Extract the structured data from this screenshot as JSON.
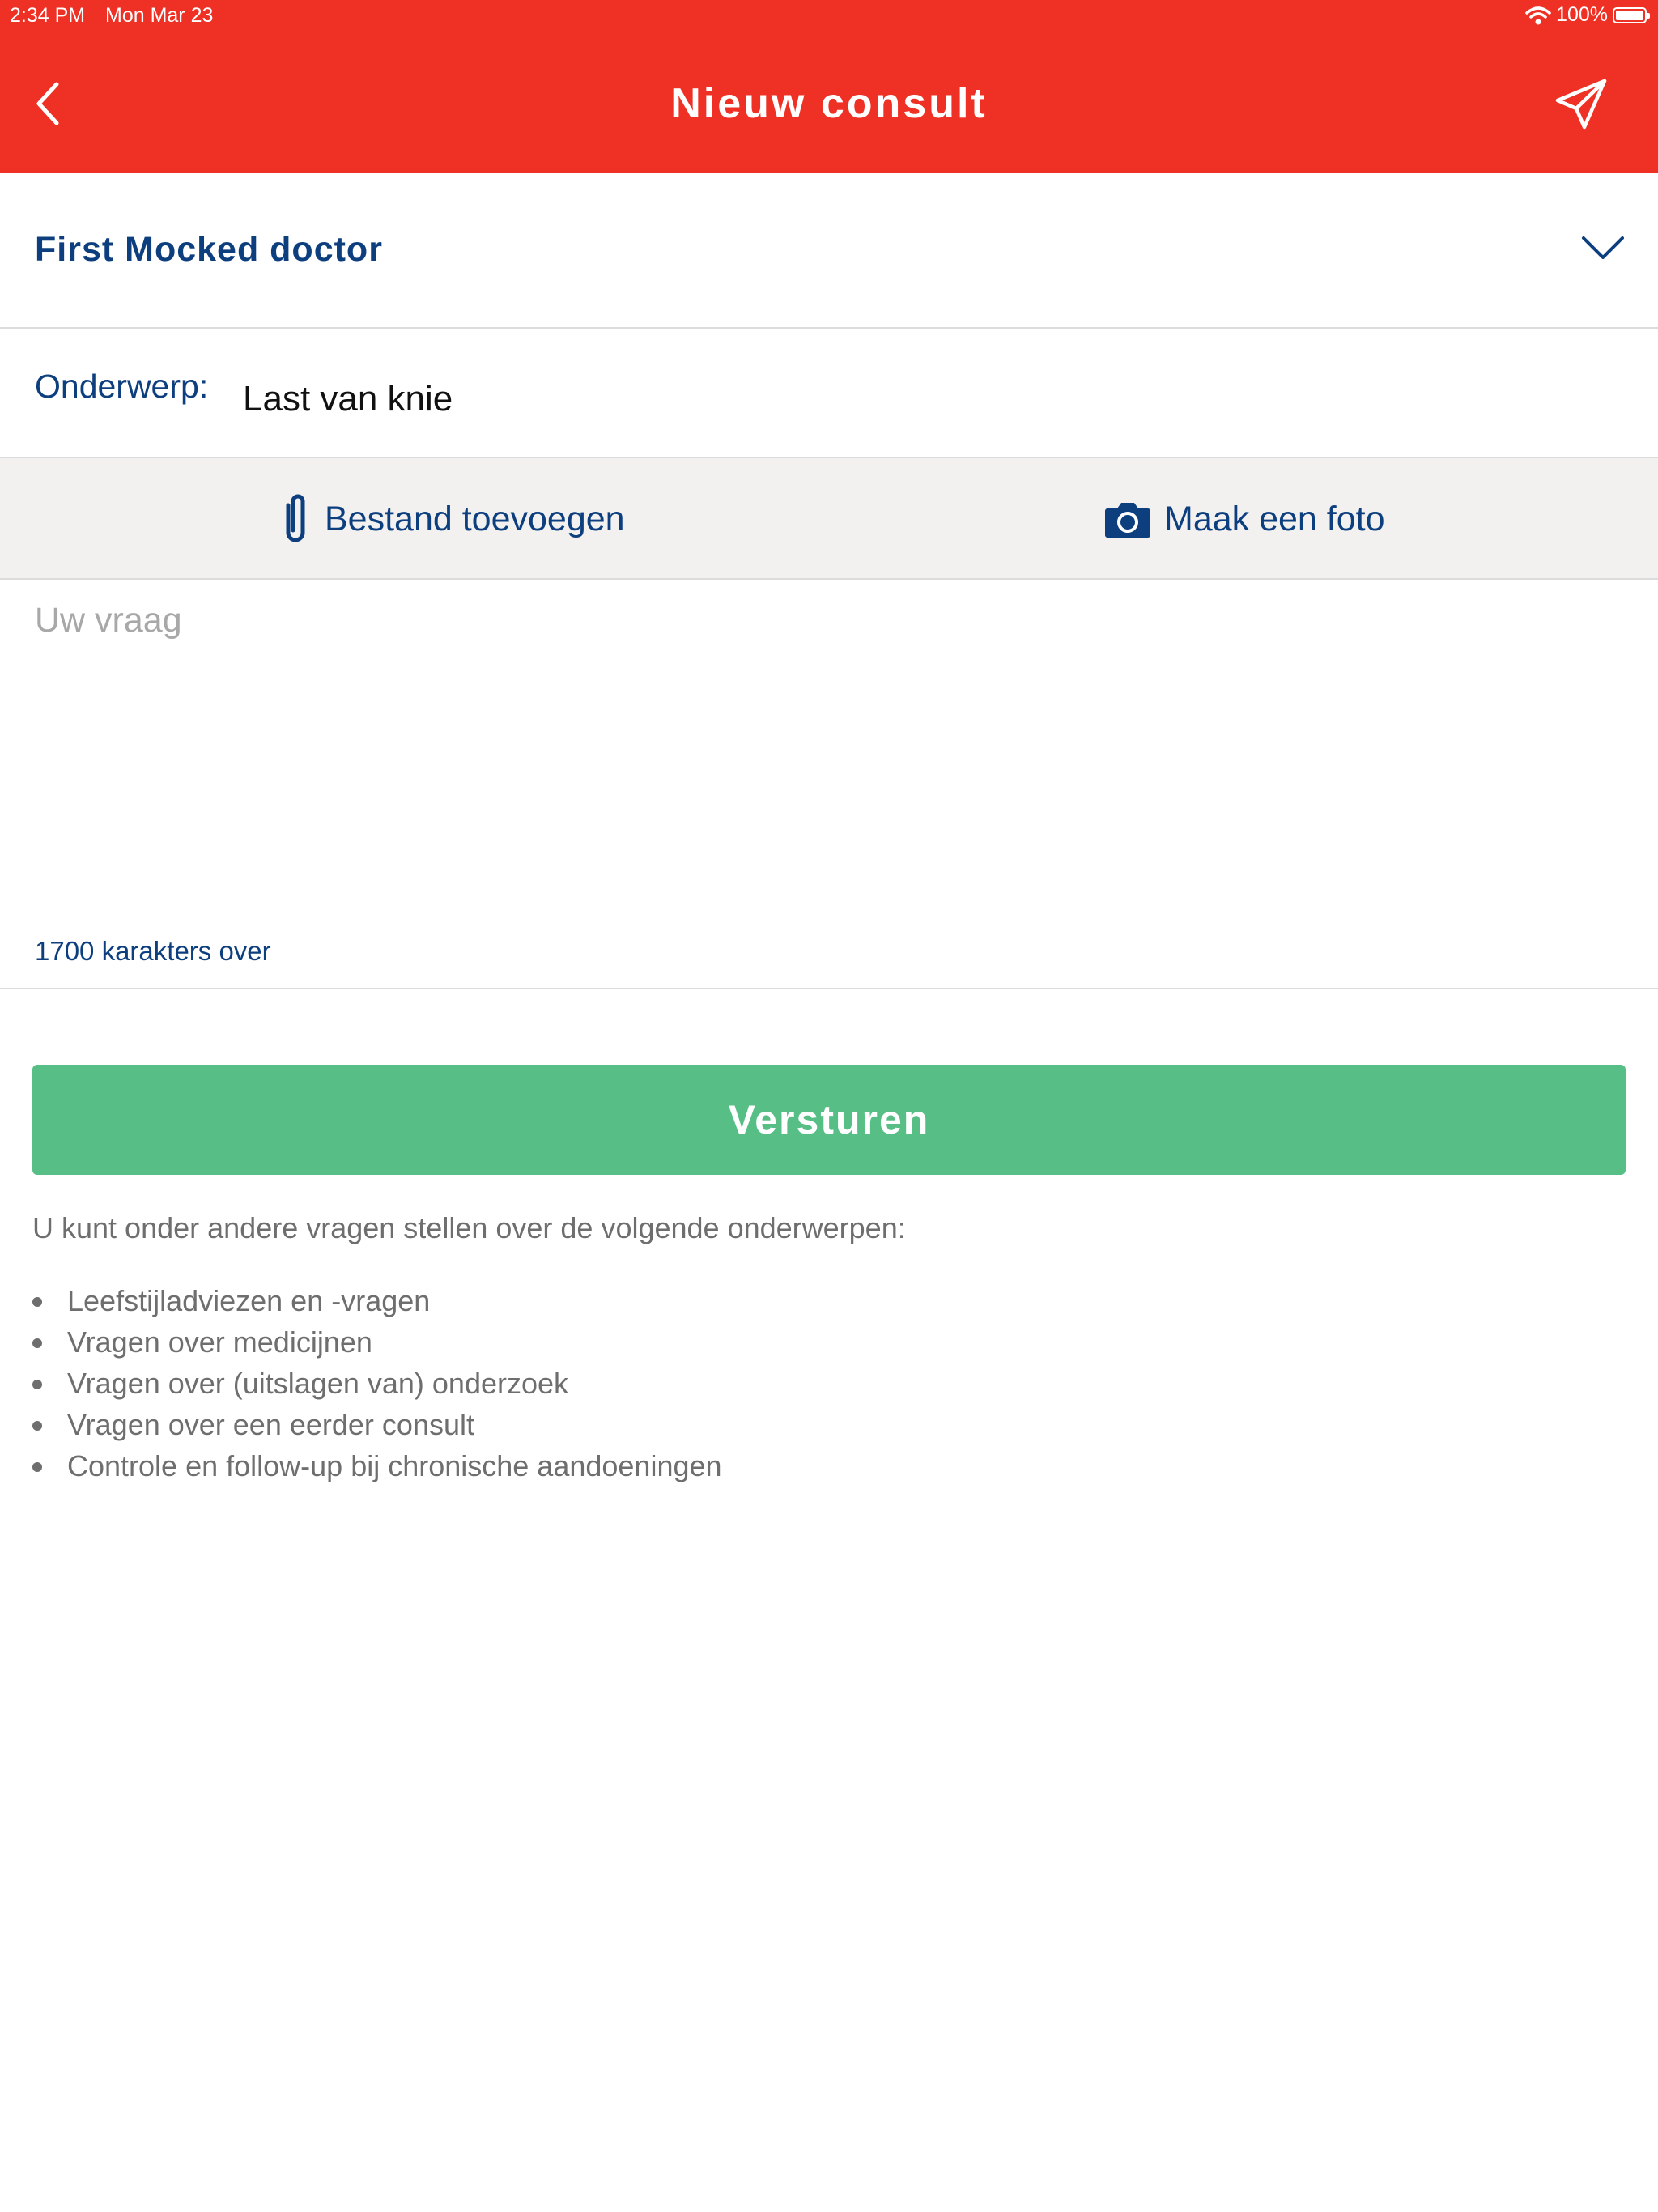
{
  "status_bar": {
    "time": "2:34 PM",
    "date": "Mon Mar 23",
    "battery": "100%"
  },
  "header": {
    "title": "Nieuw consult",
    "back_icon": "chevron-left-icon",
    "send_icon": "paper-plane-icon",
    "background_color": "#ee3124"
  },
  "doctor": {
    "selected": "First Mocked doctor"
  },
  "subject": {
    "label": "Onderwerp:",
    "value": "Last van knie"
  },
  "attachments": {
    "file_label": "Bestand toevoegen",
    "photo_label": "Maak een foto"
  },
  "question": {
    "placeholder": "Uw vraag",
    "value": "",
    "remaining": "1700 karakters over"
  },
  "submit": {
    "label": "Versturen",
    "color": "#57bf86"
  },
  "info": {
    "intro": "U kunt onder andere vragen stellen over de volgende onderwerpen:",
    "topics": [
      "Leefstijladviezen en -vragen",
      "Vragen over medicijnen",
      "Vragen over (uitslagen van) onderzoek",
      "Vragen over een eerder consult",
      "Controle en follow-up bij chronische aandoeningen"
    ]
  },
  "accent_color": "#0d3f7f"
}
